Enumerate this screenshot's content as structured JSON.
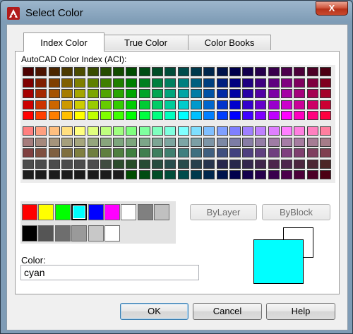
{
  "window": {
    "title": "Select Color",
    "close_glyph": "X",
    "app_icon": "autocad-logo-icon"
  },
  "tabs": [
    {
      "label": "Index Color",
      "active": true
    },
    {
      "label": "True Color",
      "active": false
    },
    {
      "label": "Color Books",
      "active": false
    }
  ],
  "aci": {
    "label": "AutoCAD Color Index (ACI):",
    "top_rows": [
      [
        "#4c0000",
        "#4c1300",
        "#4c2600",
        "#4c3900",
        "#4c4c00",
        "#394c00",
        "#264c00",
        "#134c00",
        "#004c00",
        "#004c13",
        "#004c26",
        "#004c39",
        "#004c4c",
        "#00394c",
        "#00264c",
        "#00134c",
        "#00004c",
        "#13004c",
        "#26004c",
        "#39004c",
        "#4c004c",
        "#4c0039",
        "#4c0026",
        "#4c0013"
      ],
      [
        "#7f0000",
        "#7f1f00",
        "#7f3f00",
        "#7f5f00",
        "#7f7f00",
        "#5f7f00",
        "#3f7f00",
        "#1f7f00",
        "#007f00",
        "#007f1f",
        "#007f3f",
        "#007f5f",
        "#007f7f",
        "#005f7f",
        "#003f7f",
        "#001f7f",
        "#00007f",
        "#1f007f",
        "#3f007f",
        "#5f007f",
        "#7f007f",
        "#7f005f",
        "#7f003f",
        "#7f001f"
      ],
      [
        "#a50000",
        "#a52900",
        "#a55200",
        "#a57c00",
        "#a5a500",
        "#7ca500",
        "#52a500",
        "#29a500",
        "#00a500",
        "#00a529",
        "#00a552",
        "#00a57c",
        "#00a5a5",
        "#007ca5",
        "#0052a5",
        "#0029a5",
        "#0000a5",
        "#2900a5",
        "#5200a5",
        "#7c00a5",
        "#a500a5",
        "#a5007c",
        "#a50052",
        "#a50029"
      ],
      [
        "#cc0000",
        "#cc3300",
        "#cc6600",
        "#cc9900",
        "#cccc00",
        "#99cc00",
        "#66cc00",
        "#33cc00",
        "#00cc00",
        "#00cc33",
        "#00cc66",
        "#00cc99",
        "#00cccc",
        "#0099cc",
        "#0066cc",
        "#0033cc",
        "#0000cc",
        "#3300cc",
        "#6600cc",
        "#9900cc",
        "#cc00cc",
        "#cc0099",
        "#cc0066",
        "#cc0033"
      ],
      [
        "#ff0000",
        "#ff3f00",
        "#ff7f00",
        "#ffbf00",
        "#ffff00",
        "#bfff00",
        "#7fff00",
        "#3fff00",
        "#00ff00",
        "#00ff3f",
        "#00ff7f",
        "#00ffbf",
        "#00ffff",
        "#00bfff",
        "#007fff",
        "#003fff",
        "#0000ff",
        "#3f00ff",
        "#7f00ff",
        "#bf00ff",
        "#ff00ff",
        "#ff00bf",
        "#ff007f",
        "#ff003f"
      ]
    ],
    "bottom_rows": [
      [
        "#ff7f7f",
        "#ff9f7f",
        "#ffbf7f",
        "#ffdf7f",
        "#ffff7f",
        "#dfff7f",
        "#bfff7f",
        "#9fff7f",
        "#7fff7f",
        "#7fff9f",
        "#7fffbf",
        "#7fffdf",
        "#7fffff",
        "#7fdfff",
        "#7fbfff",
        "#7f9fff",
        "#7f7fff",
        "#9f7fff",
        "#bf7fff",
        "#df7fff",
        "#ff7fff",
        "#ff7fdf",
        "#ff7fbf",
        "#ff7f9f"
      ],
      [
        "#a57c7c",
        "#a5887c",
        "#a5947c",
        "#a59f7c",
        "#a5a57c",
        "#94a57c",
        "#88a57c",
        "#7ca57c",
        "#7ca57c",
        "#7ca588",
        "#7ca594",
        "#7ca59f",
        "#7ca5a5",
        "#7c9fa5",
        "#7c94a5",
        "#7c88a5",
        "#7c7ca5",
        "#887ca5",
        "#947ca5",
        "#9f7ca5",
        "#a57ca5",
        "#a57c9f",
        "#a57c94",
        "#a57c88"
      ],
      [
        "#7f3f3f",
        "#7f4f3f",
        "#7f5f3f",
        "#7f6f3f",
        "#7f7f3f",
        "#6f7f3f",
        "#5f7f3f",
        "#4f7f3f",
        "#3f7f3f",
        "#3f7f4f",
        "#3f7f5f",
        "#3f7f6f",
        "#3f7f7f",
        "#3f6f7f",
        "#3f5f7f",
        "#3f4f7f",
        "#3f3f7f",
        "#4f3f7f",
        "#5f3f7f",
        "#6f3f7f",
        "#7f3f7f",
        "#7f3f6f",
        "#7f3f5f",
        "#7f3f4f"
      ],
      [
        "#4c4c4c",
        "#4c4c4c",
        "#4c4c4c",
        "#4c4c4c",
        "#4c4c4c",
        "#4c4c4c",
        "#3f4c3f",
        "#2c4c2c",
        "#264c26",
        "#264c33",
        "#264c3f",
        "#264c4c",
        "#264c4c",
        "#26404c",
        "#26334c",
        "#26264c",
        "#26264c",
        "#33264c",
        "#3f264c",
        "#4c264c",
        "#4c264c",
        "#4c263f",
        "#4c2633",
        "#4c2626"
      ],
      [
        "#1c1c1c",
        "#1c1c1c",
        "#1c1c1c",
        "#1c1c1c",
        "#1c1c1c",
        "#1c1c1c",
        "#1c1c1c",
        "#1c1c1c",
        "#004c00",
        "#004c13",
        "#004c26",
        "#004c39",
        "#004c4c",
        "#00394c",
        "#00264c",
        "#00134c",
        "#00004c",
        "#13004c",
        "#26004c",
        "#39004c",
        "#4c004c",
        "#4c0039",
        "#4c0026",
        "#4c0013"
      ]
    ]
  },
  "standard_colors": {
    "row1": [
      "#ff0000",
      "#ffff00",
      "#00ff00",
      "#00ffff",
      "#0000ff",
      "#ff00ff",
      "#ffffff",
      "#808080",
      "#c0c0c0"
    ],
    "row2": [
      "#000000",
      "#555555",
      "#6e6e6e",
      "#9a9a9a",
      "#c8c8c8",
      "#ffffff"
    ],
    "selected": "#00ffff"
  },
  "buttons": {
    "bylayer": "ByLayer",
    "byblock": "ByBlock",
    "ok": "OK",
    "cancel": "Cancel",
    "help": "Help"
  },
  "color_field": {
    "label": "Color:",
    "value": "cyan"
  },
  "preview": {
    "old_color": "#ffffff",
    "new_color": "#00ffff"
  }
}
